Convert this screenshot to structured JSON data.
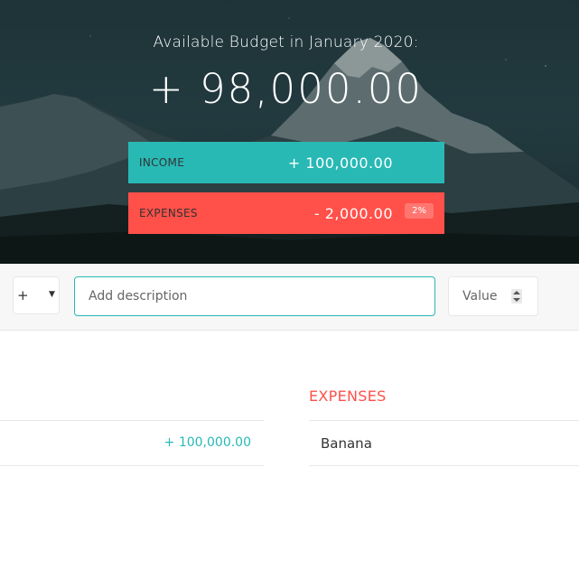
{
  "budget": {
    "title": "Available Budget in January 2020:",
    "value": "+ 98,000.00",
    "income": {
      "label": "Income",
      "value": "+ 100,000.00"
    },
    "expenses": {
      "label": "Expenses",
      "value": "- 2,000.00",
      "percentage": "2%"
    }
  },
  "add": {
    "type_value": "+",
    "description_placeholder": "Add description",
    "value_placeholder": "Value"
  },
  "income_list": [
    {
      "description": "",
      "value": "+ 100,000.00"
    }
  ],
  "expenses_list": {
    "title": "Expenses",
    "items": [
      {
        "description": "Banana"
      }
    ]
  },
  "colors": {
    "income": "#28b9b5",
    "expenses": "#ff5049",
    "hero_bg": "#223a3f"
  }
}
